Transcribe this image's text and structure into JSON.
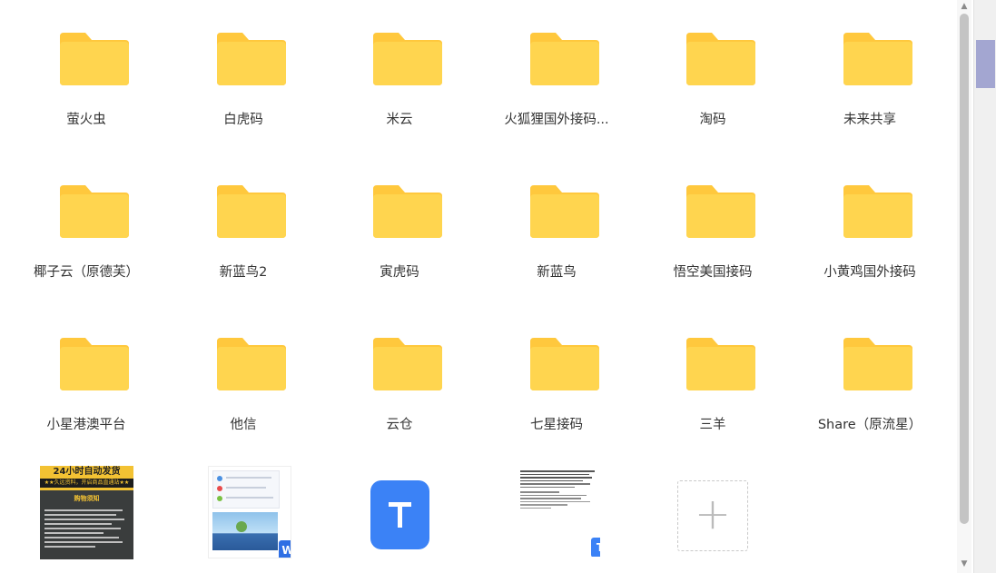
{
  "files": [
    {
      "name": "萤火虫",
      "kind": "folder"
    },
    {
      "name": "白虎码",
      "kind": "folder"
    },
    {
      "name": "米云",
      "kind": "folder"
    },
    {
      "name": "火狐狸国外接码...",
      "kind": "folder"
    },
    {
      "name": "淘码",
      "kind": "folder"
    },
    {
      "name": "未来共享",
      "kind": "folder"
    },
    {
      "name": "椰子云（原德芙）",
      "kind": "folder"
    },
    {
      "name": "新蓝鸟2",
      "kind": "folder"
    },
    {
      "name": "寅虎码",
      "kind": "folder"
    },
    {
      "name": "新蓝鸟",
      "kind": "folder"
    },
    {
      "name": "悟空美国接码",
      "kind": "folder"
    },
    {
      "name": "小黄鸡国外接码",
      "kind": "folder"
    },
    {
      "name": "小星港澳平台",
      "kind": "folder"
    },
    {
      "name": "他信",
      "kind": "folder"
    },
    {
      "name": "云仓",
      "kind": "folder"
    },
    {
      "name": "七星接码",
      "kind": "folder"
    },
    {
      "name": "三羊",
      "kind": "folder"
    },
    {
      "name": "Share（原流星）",
      "kind": "folder"
    }
  ],
  "poster_file": {
    "title_text": "24小时自动发货",
    "banner_text": "★★久远资料，开启商品直通站★★",
    "heading_text": "购物须知"
  },
  "word_badge": "W",
  "txt_badge": "T",
  "txt_icon_letter": "T",
  "add_icon": "plus-icon",
  "colors": {
    "folder": "#FFD54F",
    "folder_tab": "#FFC83D",
    "txt_blue": "#3B82F6",
    "word_badge_blue": "#2F6FE4"
  }
}
